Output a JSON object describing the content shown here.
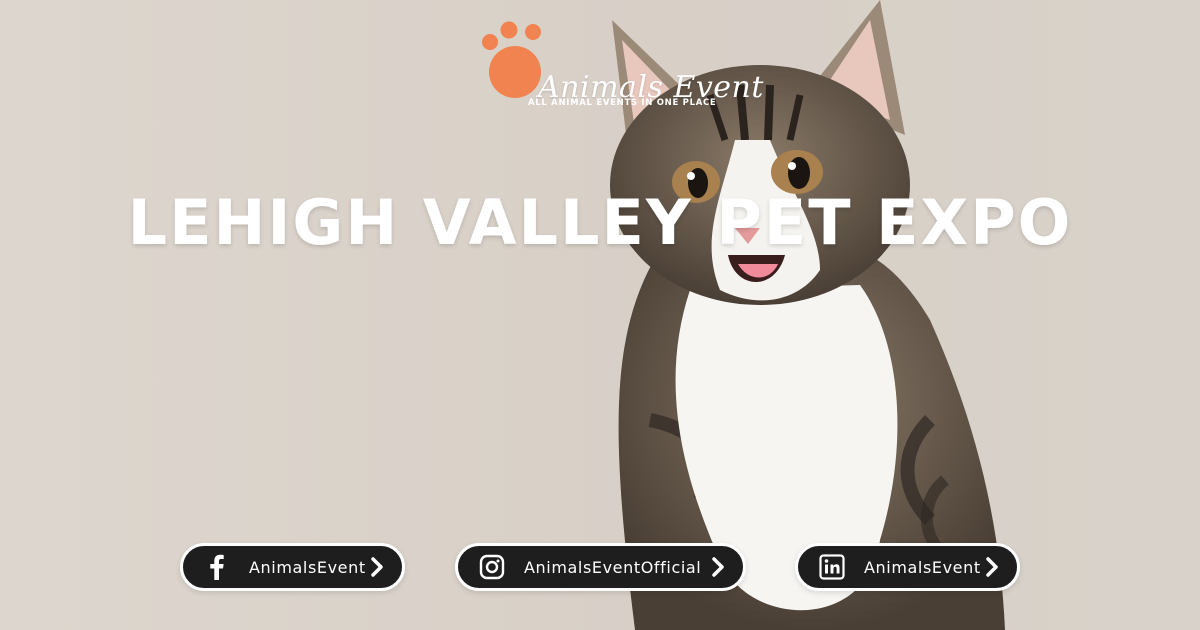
{
  "logo": {
    "name": "Animals Event",
    "tagline": "ALL ANIMAL EVENTS IN ONE PLACE"
  },
  "heading": "LEHIGH VALLEY PET EXPO",
  "socials": [
    {
      "platform": "facebook",
      "icon": "facebook-icon",
      "handle": "AnimalsEvent"
    },
    {
      "platform": "instagram",
      "icon": "instagram-icon",
      "handle": "AnimalsEventOfficial"
    },
    {
      "platform": "linkedin",
      "icon": "linkedin-icon",
      "handle": "AnimalsEvent"
    }
  ],
  "colors": {
    "brand_orange": "#f0834f",
    "background": "#d9d1c8",
    "pill": "#1e1e1e",
    "text": "#ffffff"
  }
}
